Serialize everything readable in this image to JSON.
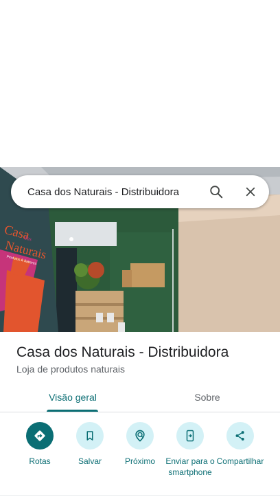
{
  "search": {
    "query": "Casa dos Naturais - Distribuidora",
    "search_icon": "search-icon",
    "close_icon": "close-icon"
  },
  "photo": {
    "banner_brand_line1": "Casa",
    "banner_brand_line2": "dos",
    "banner_brand_line3": "Naturais",
    "banner_tagline": "Produtos & Sabores"
  },
  "place": {
    "title": "Casa dos Naturais - Distribuidora",
    "category": "Loja de produtos naturais"
  },
  "tabs": [
    {
      "label": "Visão geral",
      "active": true
    },
    {
      "label": "Sobre",
      "active": false
    }
  ],
  "actions": [
    {
      "label": "Rotas",
      "icon": "directions-icon"
    },
    {
      "label": "Salvar",
      "icon": "bookmark-icon"
    },
    {
      "label": "Próximo",
      "icon": "nearby-icon"
    },
    {
      "label": "Enviar para o smartphone",
      "icon": "send-to-phone-icon"
    },
    {
      "label": "Compartilhar",
      "icon": "share-icon"
    }
  ],
  "colors": {
    "accent": "#0b6e74",
    "action_bg": "#d3f1f6",
    "wall_green": "#2c5a3b",
    "banner_orange": "#e2552e",
    "banner_pink": "#c6347a"
  }
}
